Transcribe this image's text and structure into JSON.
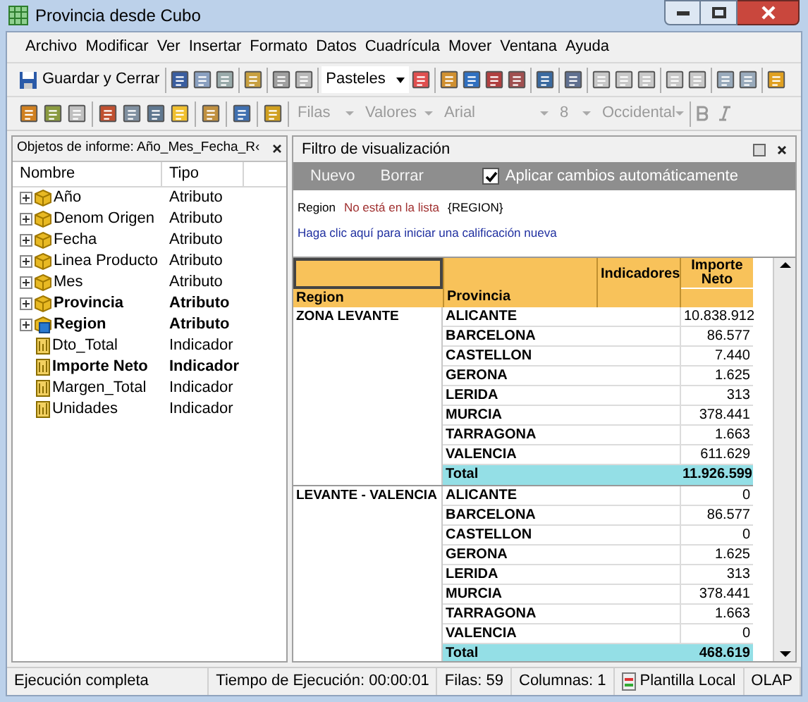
{
  "window": {
    "title": "Provincia desde Cubo"
  },
  "menu": [
    {
      "label": "Archivo"
    },
    {
      "label": "Modificar"
    },
    {
      "label": "Ver"
    },
    {
      "label": "Insertar"
    },
    {
      "label": "Formato"
    },
    {
      "label": "Datos"
    },
    {
      "label": "Cuadrícula"
    },
    {
      "label": "Mover"
    },
    {
      "label": "Ventana"
    },
    {
      "label": "Ayuda"
    }
  ],
  "toolbar": {
    "save_button": "Guardar y Cerrar",
    "chart_style": "Pasteles"
  },
  "format_bar": [
    {
      "value": "Filas",
      "disabled": true
    },
    {
      "value": "Valores",
      "disabled": true
    },
    {
      "value": "Arial",
      "disabled": true
    },
    {
      "value": "8",
      "disabled": true
    },
    {
      "value": "Occidental",
      "disabled": true
    }
  ],
  "object_panel": {
    "title": "Objetos de informe: Año_Mes_Fecha_R‹",
    "columns": [
      "Nombre",
      "Tipo"
    ],
    "items": [
      {
        "name": "Año",
        "type": "Atributo",
        "kind": "attribute",
        "bold": false
      },
      {
        "name": "Denom Origen",
        "type": "Atributo",
        "kind": "attribute",
        "bold": false
      },
      {
        "name": "Fecha",
        "type": "Atributo",
        "kind": "attribute",
        "bold": false
      },
      {
        "name": "Linea Producto",
        "type": "Atributo",
        "kind": "attribute",
        "bold": false
      },
      {
        "name": "Mes",
        "type": "Atributo",
        "kind": "attribute",
        "bold": false
      },
      {
        "name": "Provincia",
        "type": "Atributo",
        "kind": "attribute",
        "bold": true
      },
      {
        "name": "Region",
        "type": "Atributo",
        "kind": "key",
        "bold": true
      },
      {
        "name": "Dto_Total",
        "type": "Indicador",
        "kind": "metric",
        "bold": false
      },
      {
        "name": "Importe Neto",
        "type": "Indicador",
        "kind": "metric",
        "bold": true
      },
      {
        "name": "Margen_Total",
        "type": "Indicador",
        "kind": "metric",
        "bold": false
      },
      {
        "name": "Unidades",
        "type": "Indicador",
        "kind": "metric",
        "bold": false
      }
    ]
  },
  "filter_panel": {
    "title": "Filtro de visualización",
    "buttons": [
      {
        "label": "Nuevo",
        "disabled": true
      },
      {
        "label": "Borrar",
        "disabled": true
      }
    ],
    "auto_apply": {
      "label": "Aplicar cambios automáticamente",
      "checked": true
    },
    "condition": {
      "field": "Region",
      "operator": "No está en la lista",
      "value": "{REGION}"
    },
    "hint": "Haga clic aquí para iniciar una calificación nueva"
  },
  "grid": {
    "headers": {
      "region": "Region",
      "province": "Provincia",
      "metrics": "Indicadores",
      "measure": "Importe Neto"
    },
    "groups": [
      {
        "region": "ZONA LEVANTE",
        "rows": [
          {
            "province": "ALICANTE",
            "value": "10.838.912"
          },
          {
            "province": "BARCELONA",
            "value": "86.577"
          },
          {
            "province": "CASTELLON",
            "value": "7.440"
          },
          {
            "province": "GERONA",
            "value": "1.625"
          },
          {
            "province": "LERIDA",
            "value": "313"
          },
          {
            "province": "MURCIA",
            "value": "378.441"
          },
          {
            "province": "TARRAGONA",
            "value": "1.663"
          },
          {
            "province": "VALENCIA",
            "value": "611.629"
          }
        ],
        "total": {
          "label": "Total",
          "value": "11.926.599"
        }
      },
      {
        "region": "LEVANTE - VALENCIA",
        "rows": [
          {
            "province": "ALICANTE",
            "value": "0"
          },
          {
            "province": "BARCELONA",
            "value": "86.577"
          },
          {
            "province": "CASTELLON",
            "value": "0"
          },
          {
            "province": "GERONA",
            "value": "1.625"
          },
          {
            "province": "LERIDA",
            "value": "313"
          },
          {
            "province": "MURCIA",
            "value": "378.441"
          },
          {
            "province": "TARRAGONA",
            "value": "1.663"
          },
          {
            "province": "VALENCIA",
            "value": "0"
          }
        ],
        "total": {
          "label": "Total",
          "value": "468.619"
        }
      }
    ]
  },
  "status_bar": [
    {
      "text": "Ejecución completa"
    },
    {
      "text": "Tiempo de Ejecución: 00:00:01"
    },
    {
      "text": "Filas: 59"
    },
    {
      "text": "Columnas: 1"
    },
    {
      "text": "Plantilla Local",
      "kind": "template"
    },
    {
      "text": "OLAP"
    }
  ]
}
